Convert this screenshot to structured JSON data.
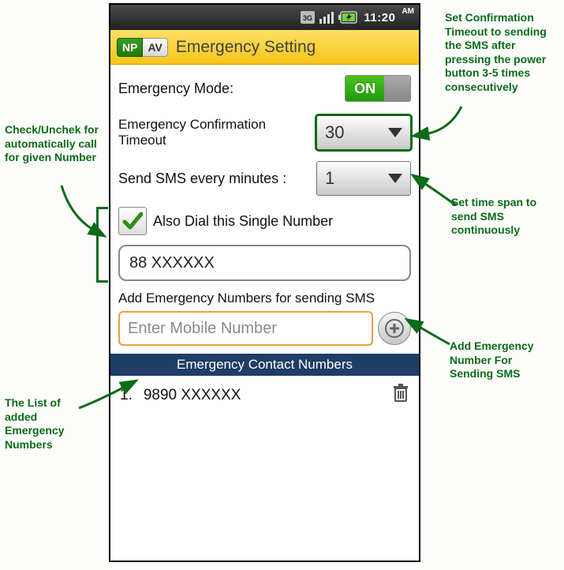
{
  "status": {
    "time": "11:20",
    "ampm": "AM"
  },
  "titlebar": {
    "np": "NP",
    "av": "AV",
    "title": "Emergency Setting"
  },
  "settings": {
    "mode_label": "Emergency Mode:",
    "mode_on": "ON",
    "timeout_label": "Emergency Confirmation Timeout",
    "timeout_value": "30",
    "interval_label": "Send SMS every minutes :",
    "interval_value": "1",
    "dial_checkbox_label": "Also Dial this Single Number",
    "dial_checked": true,
    "dial_number": "88 XXXXXX",
    "add_label": "Add Emergency Numbers for sending SMS",
    "add_placeholder": "Enter Mobile Number",
    "list_header": "Emergency Contact Numbers",
    "list": [
      {
        "idx": "1.",
        "number": "9890 XXXXXX"
      }
    ]
  },
  "annotations": {
    "timeout": "Set Confirmation Timeout to sending the SMS after pressing the power button 3-5 times consecutively",
    "interval": "Set time span to send SMS continuously",
    "dial": "Check/Unchek for automatically call for given Number",
    "add": "Add Emergency Number For Sending SMS",
    "list": "The List of added Emergency Numbers"
  }
}
